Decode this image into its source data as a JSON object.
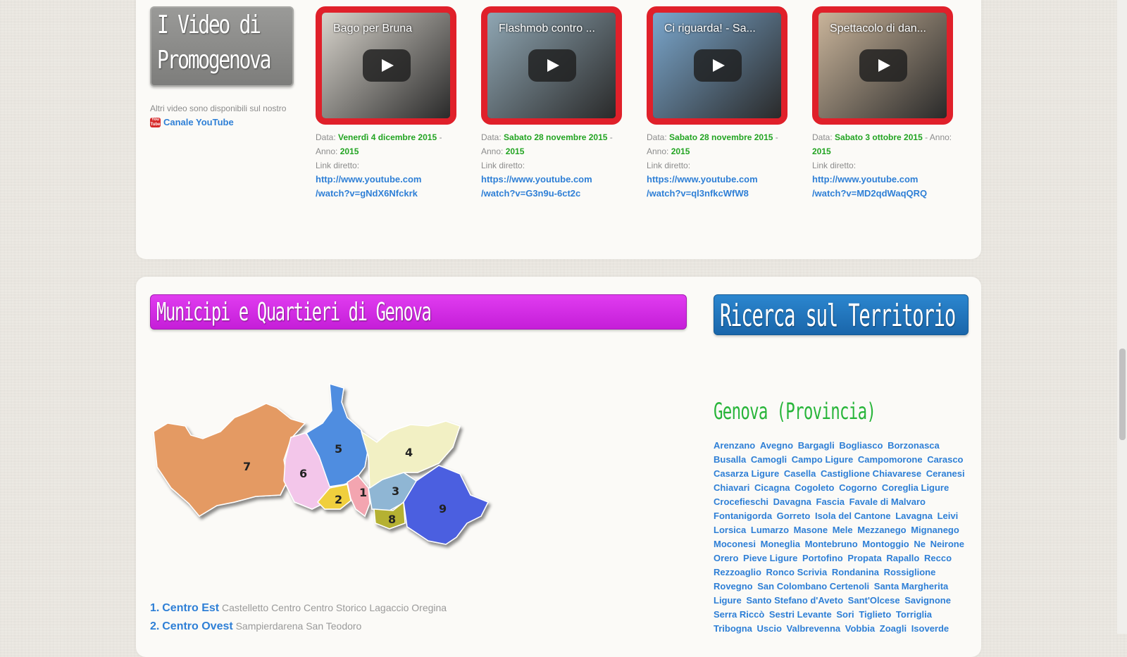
{
  "videos_section": {
    "title_line1": "I Video di",
    "title_line2": "Promogenova",
    "note": "Altri video sono disponibili sul nostro",
    "yt_icon_text": "You Tube",
    "channel_link": "Canale YouTube"
  },
  "videos": [
    {
      "title": "Bago per Bruna",
      "date_label": "Data:",
      "date": "Venerdì 4 dicembre 2015",
      "year_label": "- Anno:",
      "year": "2015",
      "link_label": "Link diretto:",
      "url1": "http://www.youtube.com",
      "url2": "/watch?v=gNdX6Nfckrk",
      "art_color": "#d8d4cc"
    },
    {
      "title": "Flashmob contro ...",
      "date_label": "Data:",
      "date": "Sabato 28 novembre 2015",
      "year_label": "- Anno:",
      "year": "2015",
      "link_label": "Link diretto:",
      "url1": "https://www.youtube.com",
      "url2": "/watch?v=G3n9u-6ct2c",
      "art_color": "#8fa6b3"
    },
    {
      "title": "Ci riguarda! - Sa...",
      "date_label": "Data:",
      "date": "Sabato 28 novembre 2015",
      "year_label": "- Anno:",
      "year": "2015",
      "link_label": "Link diretto:",
      "url1": "https://www.youtube.com",
      "url2": "/watch?v=ql3nfkcWfW8",
      "art_color": "#7aa6cc"
    },
    {
      "title": "Spettacolo di dan...",
      "date_label": "Data:",
      "date": "Sabato 3 ottobre 2015",
      "year_label": "- Anno:",
      "year": "2015",
      "link_label": "Link diretto:",
      "url1": "http://www.youtube.com",
      "url2": "/watch?v=MD2qdWaqQRQ",
      "art_color": "#c9b49a"
    }
  ],
  "map_section": {
    "title": "Municipi e Quartieri di Genova",
    "search_title": "Ricerca sul Territorio",
    "province_title": "Genova (Provincia)",
    "region_labels": [
      "7",
      "6",
      "5",
      "2",
      "1",
      "3",
      "4",
      "8",
      "9"
    ]
  },
  "quartieri": [
    {
      "num": "1.",
      "municipio": "Centro Est",
      "quartieri": "Castelletto Centro Centro Storico Lagaccio Oregina"
    },
    {
      "num": "2.",
      "municipio": "Centro Ovest",
      "quartieri": "Sampierdarena San Teodoro"
    }
  ],
  "comuni": [
    "Arenzano",
    "Avegno",
    "Bargagli",
    "Bogliasco",
    "Borzonasca",
    "Busalla",
    "Camogli",
    "Campo Ligure",
    "Campomorone",
    "Carasco",
    "Casarza Ligure",
    "Casella",
    "Castiglione Chiavarese",
    "Ceranesi",
    "Chiavari",
    "Cicagna",
    "Cogoleto",
    "Cogorno",
    "Coreglia Ligure",
    "Crocefieschi",
    "Davagna",
    "Fascia",
    "Favale di Malvaro",
    "Fontanigorda",
    "Gorreto",
    "Isola del Cantone",
    "Lavagna",
    "Leivi",
    "Lorsica",
    "Lumarzo",
    "Masone",
    "Mele",
    "Mezzanego",
    "Mignanego",
    "Moconesi",
    "Moneglia",
    "Montebruno",
    "Montoggio",
    "Ne",
    "Neirone",
    "Orero",
    "Pieve Ligure",
    "Portofino",
    "Propata",
    "Rapallo",
    "Recco",
    "Rezzoaglio",
    "Ronco Scrivia",
    "Rondanina",
    "Rossiglione",
    "Rovegno",
    "San Colombano Certenoli",
    "Santa Margherita Ligure",
    "Santo Stefano d'Aveto",
    "Sant'Olcese",
    "Savignone",
    "Serra Riccò",
    "Sestri Levante",
    "Sori",
    "Tiglieto",
    "Torriglia",
    "Tribogna",
    "Uscio",
    "Valbrevenna",
    "Vobbia",
    "Zoagli",
    "Isoverde"
  ]
}
